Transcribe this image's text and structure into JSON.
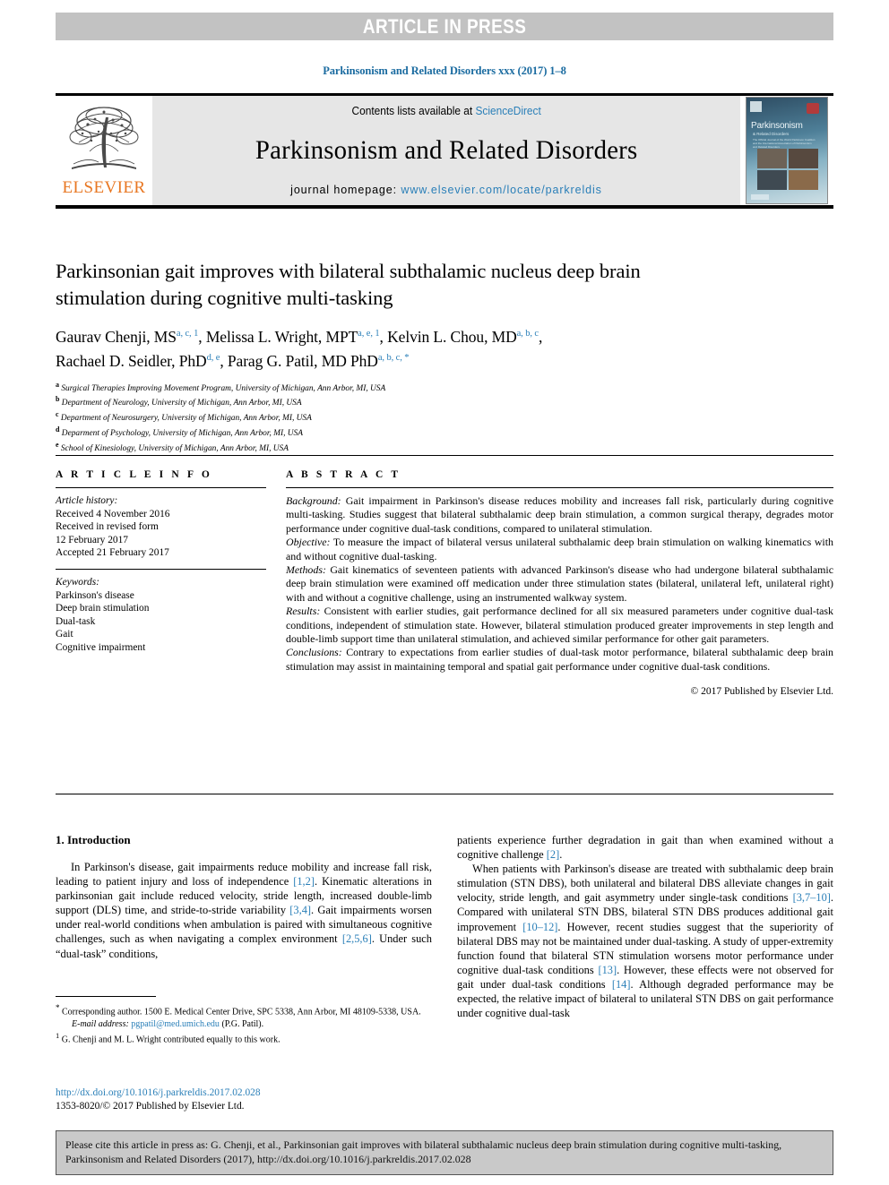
{
  "banner": {
    "label": "ARTICLE IN PRESS"
  },
  "running_head": "Parkinsonism and Related Disorders xxx (2017) 1–8",
  "masthead": {
    "publisher": "ELSEVIER",
    "contents_prefix": "Contents lists available at ",
    "contents_link": "ScienceDirect",
    "journal_name": "Parkinsonism and Related Disorders",
    "homepage_prefix": "journal homepage: ",
    "homepage_url": "www.elsevier.com/locate/parkreldis",
    "cover": {
      "title": "Parkinsonism",
      "subtitle": "& Related Disorders",
      "blurb": "The Official Journal of the World Parkinson Coalition and the International Association of Parkinsonism and Related Disorders"
    }
  },
  "article": {
    "title": "Parkinsonian gait improves with bilateral subthalamic nucleus deep brain stimulation during cognitive multi-tasking",
    "authors": [
      {
        "name": "Gaurav Chenji, MS",
        "marks": "a, c, 1"
      },
      {
        "name": "Melissa L. Wright, MPT",
        "marks": "a, e, 1"
      },
      {
        "name": "Kelvin L. Chou, MD",
        "marks": "a, b, c"
      },
      {
        "name": "Rachael D. Seidler, PhD",
        "marks": "d, e"
      },
      {
        "name": "Parag G. Patil, MD PhD",
        "marks": "a, b, c, *"
      }
    ],
    "affiliations": [
      {
        "mark": "a",
        "text": "Surgical Therapies Improving Movement Program, University of Michigan, Ann Arbor, MI, USA"
      },
      {
        "mark": "b",
        "text": "Department of Neurology, University of Michigan, Ann Arbor, MI, USA"
      },
      {
        "mark": "c",
        "text": "Department of Neurosurgery, University of Michigan, Ann Arbor, MI, USA"
      },
      {
        "mark": "d",
        "text": "Deparment of Psychology, University of Michigan, Ann Arbor, MI, USA"
      },
      {
        "mark": "e",
        "text": "School of Kinesiology, University of Michigan, Ann Arbor, MI, USA"
      }
    ]
  },
  "article_info": {
    "heading": "A R T I C L E   I N F O",
    "history_label": "Article history:",
    "history": [
      "Received 4 November 2016",
      "Received in revised form",
      "12 February 2017",
      "Accepted 21 February 2017"
    ],
    "keywords_label": "Keywords:",
    "keywords": [
      "Parkinson's disease",
      "Deep brain stimulation",
      "Dual-task",
      "Gait",
      "Cognitive impairment"
    ]
  },
  "abstract": {
    "heading": "A B S T R A C T",
    "sections": [
      {
        "label": "Background:",
        "text": " Gait impairment in Parkinson's disease reduces mobility and increases fall risk, particularly during cognitive multi-tasking. Studies suggest that bilateral subthalamic deep brain stimulation, a common surgical therapy, degrades motor performance under cognitive dual-task conditions, compared to unilateral stimulation."
      },
      {
        "label": "Objective:",
        "text": " To measure the impact of bilateral versus unilateral subthalamic deep brain stimulation on walking kinematics with and without cognitive dual-tasking."
      },
      {
        "label": "Methods:",
        "text": " Gait kinematics of seventeen patients with advanced Parkinson's disease who had undergone bilateral subthalamic deep brain stimulation were examined off medication under three stimulation states (bilateral, unilateral left, unilateral right) with and without a cognitive challenge, using an instrumented walkway system."
      },
      {
        "label": "Results:",
        "text": " Consistent with earlier studies, gait performance declined for all six measured parameters under cognitive dual-task conditions, independent of stimulation state. However, bilateral stimulation produced greater improvements in step length and double-limb support time than unilateral stimulation, and achieved similar performance for other gait parameters."
      },
      {
        "label": "Conclusions:",
        "text": " Contrary to expectations from earlier studies of dual-task motor performance, bilateral subthalamic deep brain stimulation may assist in maintaining temporal and spatial gait performance under cognitive dual-task conditions."
      }
    ],
    "copyright": "© 2017 Published by Elsevier Ltd."
  },
  "introduction": {
    "heading": "1. Introduction",
    "left_paragraph": "In Parkinson's disease, gait impairments reduce mobility and increase fall risk, leading to patient injury and loss of independence [1,2]. Kinematic alterations in parkinsonian gait include reduced velocity, stride length, increased double-limb support (DLS) time, and stride-to-stride variability [3,4]. Gait impairments worsen under real-world conditions when ambulation is paired with simultaneous cognitive challenges, such as when navigating a complex environment [2,5,6]. Under such “dual-task” conditions,",
    "right_paragraph_1": "patients experience further degradation in gait than when examined without a cognitive challenge [2].",
    "right_paragraph_2": "When patients with Parkinson's disease are treated with subthalamic deep brain stimulation (STN DBS), both unilateral and bilateral DBS alleviate changes in gait velocity, stride length, and gait asymmetry under single-task conditions [3,7–10]. Compared with unilateral STN DBS, bilateral STN DBS produces additional gait improvement [10–12]. However, recent studies suggest that the superiority of bilateral DBS may not be maintained under dual-tasking. A study of upper-extremity function found that bilateral STN stimulation worsens motor performance under cognitive dual-task conditions [13]. However, these effects were not observed for gait under dual-task conditions [14]. Although degraded performance may be expected, the relative impact of bilateral to unilateral STN DBS on gait performance under cognitive dual-task"
  },
  "footnote": {
    "corresponding": "Corresponding author. 1500 E. Medical Center Drive, SPC 5338, Ann Arbor, MI 48109-5338, USA.",
    "email_label": "E-mail address:",
    "email": "pgpatil@med.umich.edu",
    "email_owner": "(P.G. Patil).",
    "equal_contrib": "G. Chenji and M. L. Wright contributed equally to this work."
  },
  "doi_block": {
    "doi": "http://dx.doi.org/10.1016/j.parkreldis.2017.02.028",
    "issn_line": "1353-8020/© 2017 Published by Elsevier Ltd."
  },
  "cite_box": {
    "text": "Please cite this article in press as: G. Chenji, et al., Parkinsonian gait improves with bilateral subthalamic nucleus deep brain stimulation during cognitive multi-tasking, Parkinsonism and Related Disorders (2017), http://dx.doi.org/10.1016/j.parkreldis.2017.02.028"
  },
  "colors": {
    "link": "#2a7fb8",
    "banner_bg": "#c2c2c2",
    "masthead_bg": "#e6e6e6",
    "elsevier_orange": "#e87722",
    "cite_bg": "#c9c9c9"
  }
}
